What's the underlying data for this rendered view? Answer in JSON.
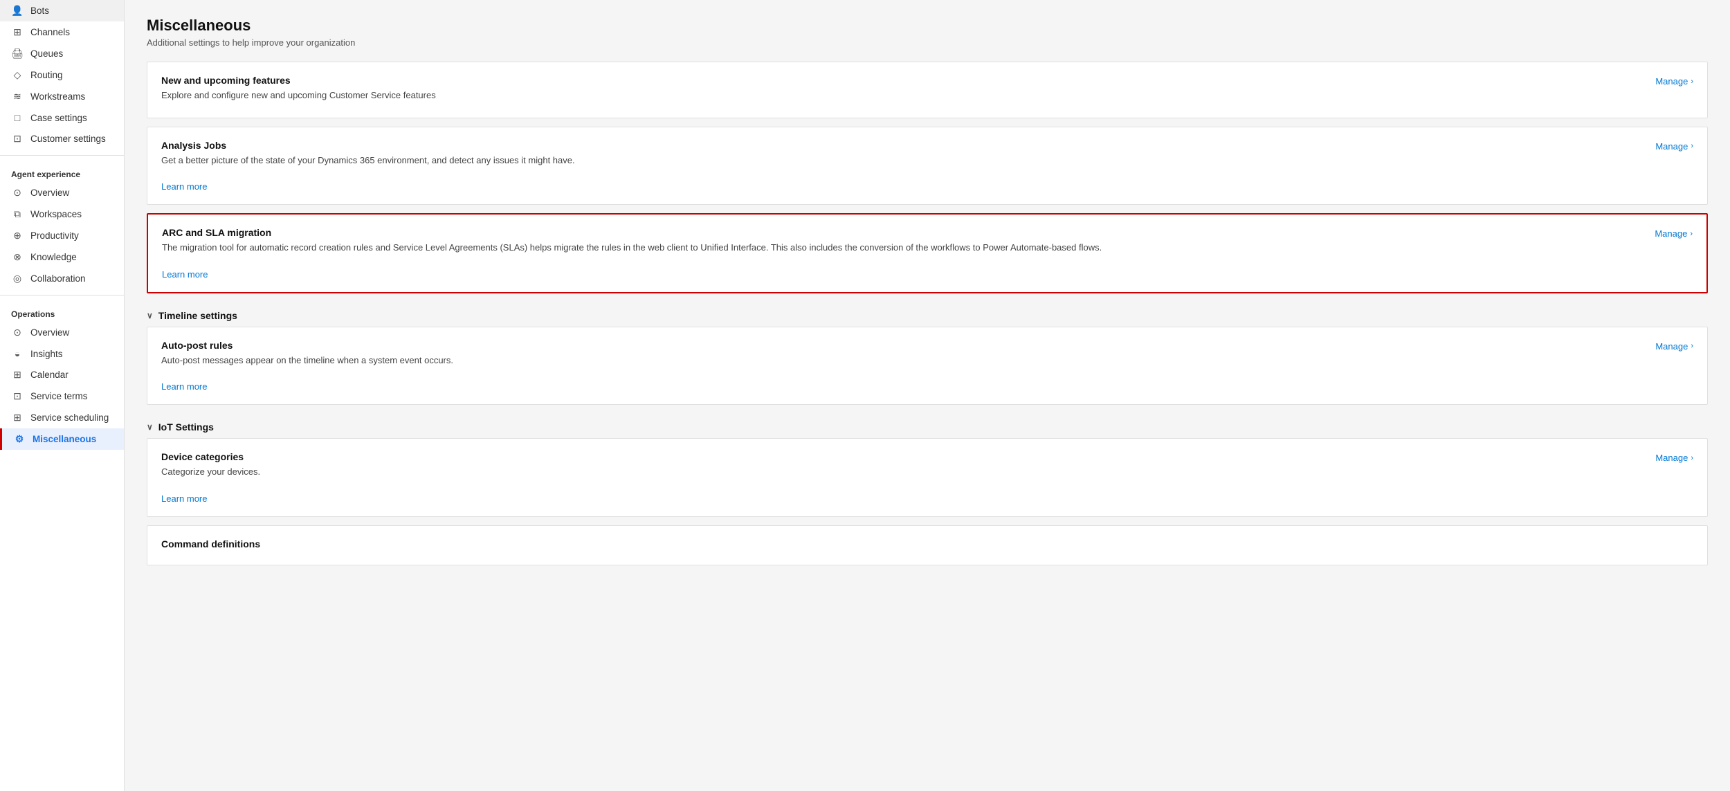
{
  "sidebar": {
    "items_top": [
      {
        "id": "bots",
        "label": "Bots",
        "icon": "👤"
      },
      {
        "id": "channels",
        "label": "Channels",
        "icon": "⊞"
      },
      {
        "id": "queues",
        "label": "Queues",
        "icon": "🖨"
      },
      {
        "id": "routing",
        "label": "Routing",
        "icon": "◇"
      },
      {
        "id": "workstreams",
        "label": "Workstreams",
        "icon": "≋"
      },
      {
        "id": "case-settings",
        "label": "Case settings",
        "icon": "□"
      },
      {
        "id": "customer-settings",
        "label": "Customer settings",
        "icon": "⊡"
      }
    ],
    "agent_experience_label": "Agent experience",
    "items_agent": [
      {
        "id": "overview-agent",
        "label": "Overview",
        "icon": "⊙"
      },
      {
        "id": "workspaces",
        "label": "Workspaces",
        "icon": "⧉"
      },
      {
        "id": "productivity",
        "label": "Productivity",
        "icon": "⊕"
      },
      {
        "id": "knowledge",
        "label": "Knowledge",
        "icon": "⊗"
      },
      {
        "id": "collaboration",
        "label": "Collaboration",
        "icon": "◎"
      }
    ],
    "operations_label": "Operations",
    "items_operations": [
      {
        "id": "overview-ops",
        "label": "Overview",
        "icon": "⊙"
      },
      {
        "id": "insights",
        "label": "Insights",
        "icon": "◒"
      },
      {
        "id": "calendar",
        "label": "Calendar",
        "icon": "⊞"
      },
      {
        "id": "service-terms",
        "label": "Service terms",
        "icon": "⊡"
      },
      {
        "id": "service-scheduling",
        "label": "Service scheduling",
        "icon": "⊞"
      },
      {
        "id": "miscellaneous",
        "label": "Miscellaneous",
        "icon": "⚙",
        "active": true
      }
    ]
  },
  "main": {
    "title": "Miscellaneous",
    "subtitle": "Additional settings to help improve your organization",
    "cards_top": [
      {
        "id": "new-features",
        "title": "New and upcoming features",
        "desc": "Explore and configure new and upcoming Customer Service features",
        "link": null,
        "manage": "Manage",
        "highlighted": false
      },
      {
        "id": "analysis-jobs",
        "title": "Analysis Jobs",
        "desc": "Get a better picture of the state of your Dynamics 365 environment, and detect any issues it might have.",
        "link": "Learn more",
        "manage": "Manage",
        "highlighted": false
      },
      {
        "id": "arc-sla",
        "title": "ARC and SLA migration",
        "desc": "The migration tool for automatic record creation rules and Service Level Agreements (SLAs) helps migrate the rules in the web client to Unified Interface. This also includes the conversion of the workflows to Power Automate-based flows.",
        "link": "Learn more",
        "manage": "Manage",
        "highlighted": true
      }
    ],
    "sections": [
      {
        "id": "timeline-settings",
        "label": "Timeline settings",
        "cards": [
          {
            "id": "auto-post-rules",
            "title": "Auto-post rules",
            "desc": "Auto-post messages appear on the timeline when a system event occurs.",
            "link": "Learn more",
            "manage": "Manage",
            "highlighted": false
          }
        ]
      },
      {
        "id": "iot-settings",
        "label": "IoT Settings",
        "cards": [
          {
            "id": "device-categories",
            "title": "Device categories",
            "desc": "Categorize your devices.",
            "link": "Learn more",
            "manage": "Manage",
            "highlighted": false
          },
          {
            "id": "command-definitions",
            "title": "Command definitions",
            "desc": "",
            "link": null,
            "manage": null,
            "highlighted": false
          }
        ]
      }
    ]
  }
}
